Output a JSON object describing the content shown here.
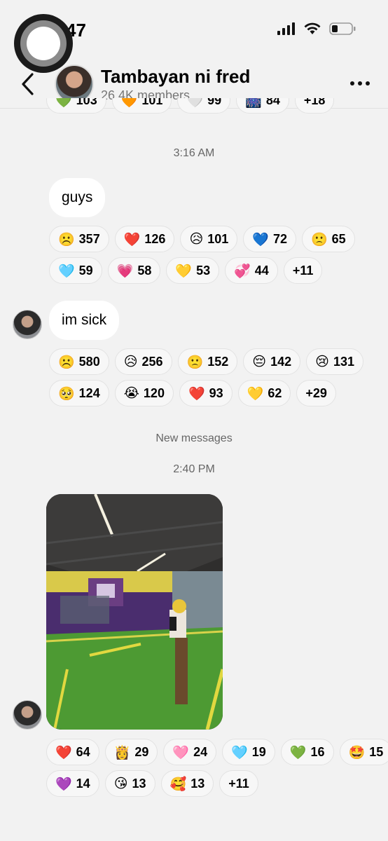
{
  "status_bar": {
    "time": "47"
  },
  "header": {
    "title": "Tambayan ni fred",
    "subtitle": "26.4K members"
  },
  "top_partial_reactions": [
    {
      "icon": "green-heart",
      "emoji": "💚",
      "count": "103"
    },
    {
      "icon": "orange-heart",
      "emoji": "🧡",
      "count": "101"
    },
    {
      "icon": "white-heart",
      "emoji": "🤍",
      "count": "99"
    },
    {
      "icon": "sparkle",
      "emoji": "🎆",
      "count": "84"
    },
    {
      "icon": "",
      "emoji": "",
      "count": "+18"
    }
  ],
  "timestamps": {
    "first": "3:16 AM",
    "second": "2:40 PM"
  },
  "divider": "New messages",
  "msg1": {
    "text": "guys",
    "reactions_row1": [
      {
        "icon": "frowning-face",
        "emoji": "☹️",
        "count": "357"
      },
      {
        "icon": "red-heart",
        "emoji": "❤️",
        "count": "126"
      },
      {
        "icon": "sad-sweat-face",
        "emoji": "😥",
        "count": "101"
      },
      {
        "icon": "blue-heart",
        "emoji": "💙",
        "count": "72"
      },
      {
        "icon": "slightly-frowning-face",
        "emoji": "🙁",
        "count": "65"
      }
    ],
    "reactions_row2": [
      {
        "icon": "light-blue-heart",
        "emoji": "🩵",
        "count": "59"
      },
      {
        "icon": "growing-heart",
        "emoji": "💗",
        "count": "58"
      },
      {
        "icon": "yellow-heart",
        "emoji": "💛",
        "count": "53"
      },
      {
        "icon": "revolving-hearts",
        "emoji": "💞",
        "count": "44"
      },
      {
        "icon": "",
        "emoji": "",
        "count": "+11"
      }
    ]
  },
  "msg2": {
    "text": "im sick",
    "reactions_row1": [
      {
        "icon": "frowning-face",
        "emoji": "☹️",
        "count": "580"
      },
      {
        "icon": "sad-sweat-face",
        "emoji": "😥",
        "count": "256"
      },
      {
        "icon": "slightly-frowning-face",
        "emoji": "🙁",
        "count": "152"
      },
      {
        "icon": "pensive-face",
        "emoji": "😔",
        "count": "142"
      },
      {
        "icon": "crying-face",
        "emoji": "😢",
        "count": "131"
      }
    ],
    "reactions_row2": [
      {
        "icon": "pleading-face",
        "emoji": "🥺",
        "count": "124"
      },
      {
        "icon": "loudly-crying-face",
        "emoji": "😭",
        "count": "120"
      },
      {
        "icon": "red-heart",
        "emoji": "❤️",
        "count": "93"
      },
      {
        "icon": "yellow-heart",
        "emoji": "💛",
        "count": "62"
      },
      {
        "icon": "",
        "emoji": "",
        "count": "+29"
      }
    ]
  },
  "msg3": {
    "reactions_row1": [
      {
        "icon": "red-heart",
        "emoji": "❤️",
        "count": "64"
      },
      {
        "icon": "princess",
        "emoji": "👸",
        "count": "29"
      },
      {
        "icon": "pink-heart",
        "emoji": "🩷",
        "count": "24"
      },
      {
        "icon": "light-blue-heart",
        "emoji": "🩵",
        "count": "19"
      },
      {
        "icon": "green-heart",
        "emoji": "💚",
        "count": "16"
      },
      {
        "icon": "star-struck-face",
        "emoji": "🤩",
        "count": "15"
      }
    ],
    "reactions_row2": [
      {
        "icon": "purple-heart",
        "emoji": "💜",
        "count": "14"
      },
      {
        "icon": "kissing-face",
        "emoji": "😘",
        "count": "13"
      },
      {
        "icon": "smiling-face-with-hearts",
        "emoji": "🥰",
        "count": "13"
      },
      {
        "icon": "",
        "emoji": "",
        "count": "+11"
      }
    ]
  }
}
